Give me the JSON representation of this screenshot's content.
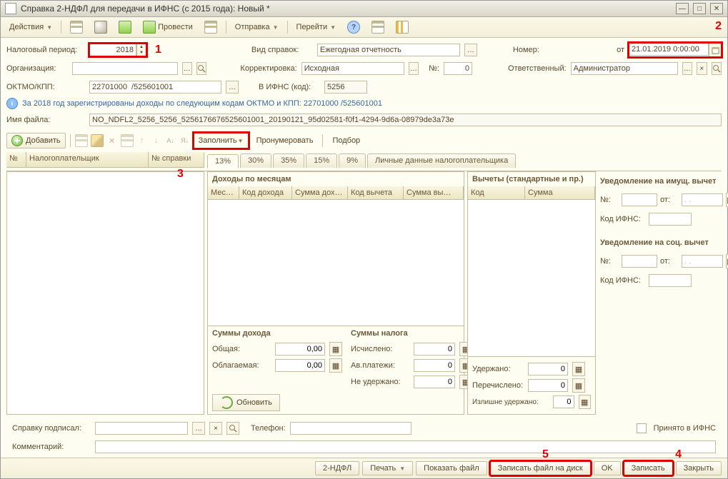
{
  "window": {
    "title": "Справка 2-НДФЛ для передачи в ИФНС (с 2015 года): Новый *"
  },
  "toolbar": {
    "actions": "Действия",
    "post": "Провести",
    "send": "Отправка",
    "goto": "Перейти"
  },
  "callouts": {
    "c1": "1",
    "c2": "2",
    "c3": "3",
    "c4": "4",
    "c5": "5"
  },
  "header": {
    "tax_period_lbl": "Налоговый период:",
    "tax_period": "2018",
    "org_lbl": "Организация:",
    "org": "",
    "oktmo_lbl": "ОКТМО/КПП:",
    "oktmo": "22701000  /525601001",
    "cert_type_lbl": "Вид справок:",
    "cert_type": "Ежегодная отчетность",
    "adj_lbl": "Корректировка:",
    "adj": "Исходная",
    "num_short": "№:",
    "num_short_val": "0",
    "ifns_lbl": "В ИФНС (код):",
    "ifns": "5256",
    "number_lbl": "Номер:",
    "date_from": "от",
    "date_val": "21.01.2019 0:00:00",
    "resp_lbl": "Ответственный:",
    "resp": "Администратор",
    "info": "За 2018 год зарегистрированы доходы по следующим кодам ОКТМО и КПП: 22701000  /525601001",
    "file_lbl": "Имя файла:",
    "file": "NO_NDFL2_5256_5256_5256176676525601001_20190121_95d02581-f0f1-4294-9d6a-08979de3a73e"
  },
  "toolbar2": {
    "add": "Добавить",
    "fill": "Заполнить",
    "renumber": "Пронумеровать",
    "select": "Подбор"
  },
  "left_cols": {
    "num": "№",
    "payer": "Налогоплательщик",
    "cert_no": "№ справки"
  },
  "tabs": [
    "13%",
    "30%",
    "35%",
    "15%",
    "9%",
    "Личные данные налогоплательщика"
  ],
  "inc": {
    "title": "Доходы по месяцам",
    "cols": [
      "Мес…",
      "Код дохода",
      "Сумма дох…",
      "Код вычета",
      "Сумма вы…"
    ]
  },
  "ded": {
    "title": "Вычеты (стандартные и пр.)",
    "cols": [
      "Код",
      "Сумма"
    ]
  },
  "notice_prop": {
    "title": "Уведомление на имущ. вычет",
    "num": "№:",
    "from": "от:",
    "date_ph": ". .",
    "ifns_lbl": "Код ИФНС:"
  },
  "notice_soc": {
    "title": "Уведомление на соц. вычет",
    "num": "№:",
    "from": "от:",
    "date_ph": ". .",
    "ifns_lbl": "Код ИФНС:"
  },
  "sums": {
    "inc_title": "Суммы дохода",
    "tax_title": "Суммы налога",
    "total": "Общая:",
    "total_v": "0,00",
    "taxable": "Облагаемая:",
    "taxable_v": "0,00",
    "calc": "Исчислено:",
    "calc_v": "0",
    "adv": "Ав.платежи:",
    "adv_v": "0",
    "nothold": "Не удержано:",
    "nothold_v": "0",
    "hold": "Удержано:",
    "hold_v": "0",
    "trans": "Перечислено:",
    "trans_v": "0",
    "over": "Излишне удержано:",
    "over_v": "0",
    "refresh": "Обновить"
  },
  "bottom": {
    "signed_lbl": "Справку подписал:",
    "phone_lbl": "Телефон:",
    "accepted": "Принято в ИФНС",
    "comment_lbl": "Комментарий:"
  },
  "footer": {
    "ndfl": "2-НДФЛ",
    "print": "Печать",
    "show": "Показать файл",
    "save_file": "Записать файл на диск",
    "ok": "OK",
    "save": "Записать",
    "close": "Закрыть"
  }
}
